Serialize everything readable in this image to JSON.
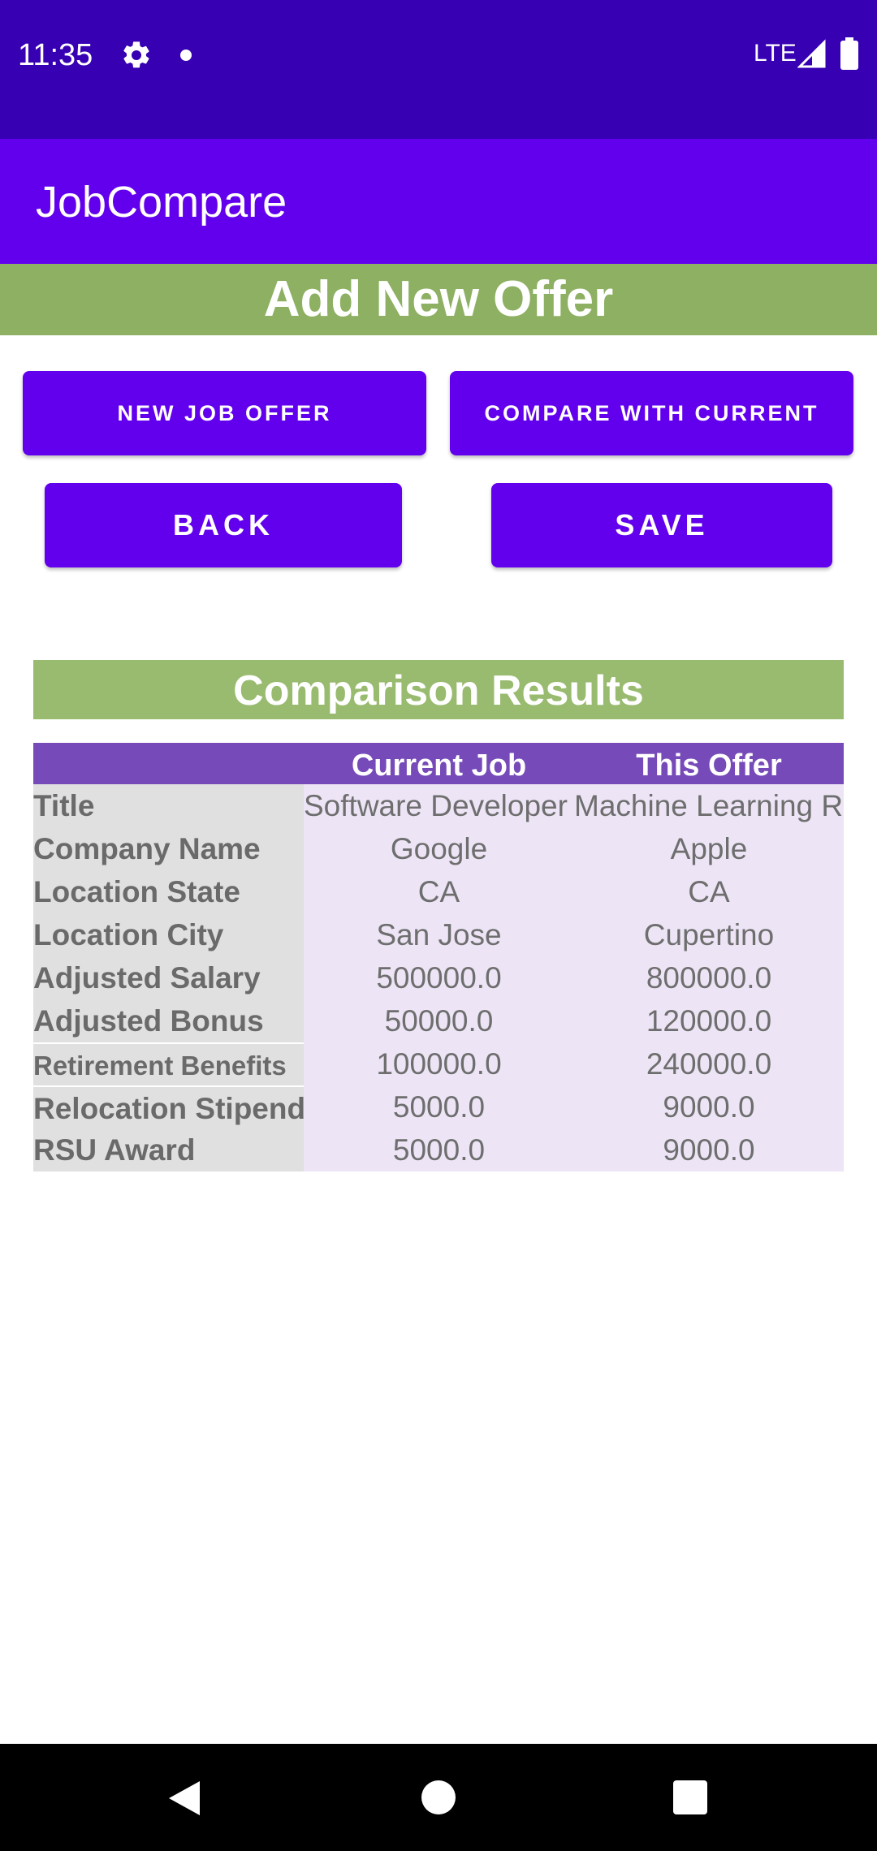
{
  "status_bar": {
    "time": "11:35",
    "network": "LTE",
    "icons": [
      "gear-icon",
      "notification-dot-icon",
      "signal-icon",
      "battery-icon"
    ]
  },
  "app_bar": {
    "title": "JobCompare"
  },
  "page": {
    "header": "Add New Offer"
  },
  "buttons": {
    "new_job_offer": "NEW JOB OFFER",
    "compare_with_current": "COMPARE WITH CURRENT",
    "back": "BACK",
    "save": "SAVE"
  },
  "comparison": {
    "title": "Comparison Results",
    "columns": [
      "",
      "Current Job",
      "This Offer"
    ],
    "rows": [
      {
        "label": "Title",
        "current": "Software Developer",
        "offer": "Machine Learning R"
      },
      {
        "label": "Company Name",
        "current": "Google",
        "offer": "Apple"
      },
      {
        "label": "Location State",
        "current": "CA",
        "offer": "CA"
      },
      {
        "label": "Location City",
        "current": "San Jose",
        "offer": "Cupertino"
      },
      {
        "label": "Adjusted Salary",
        "current": "500000.0",
        "offer": "800000.0"
      },
      {
        "label": "Adjusted Bonus",
        "current": "50000.0",
        "offer": "120000.0"
      },
      {
        "label": "Retirement Benefits",
        "current": "100000.0",
        "offer": "240000.0"
      },
      {
        "label": "Relocation Stipend",
        "current": "5000.0",
        "offer": "9000.0"
      },
      {
        "label": "RSU Award",
        "current": "5000.0",
        "offer": "9000.0"
      }
    ]
  },
  "colors": {
    "status_bar": "#3700b3",
    "app_bar": "#6200ee",
    "button": "#6200ee",
    "header_green": "#8db062",
    "comparison_green": "#99bb6f",
    "table_header_purple": "#764ab8",
    "label_cell": "#e0e0e0",
    "value_cell": "#ede5f6"
  },
  "nav_bar": {
    "icons": [
      "back-icon",
      "home-icon",
      "recents-icon"
    ]
  }
}
